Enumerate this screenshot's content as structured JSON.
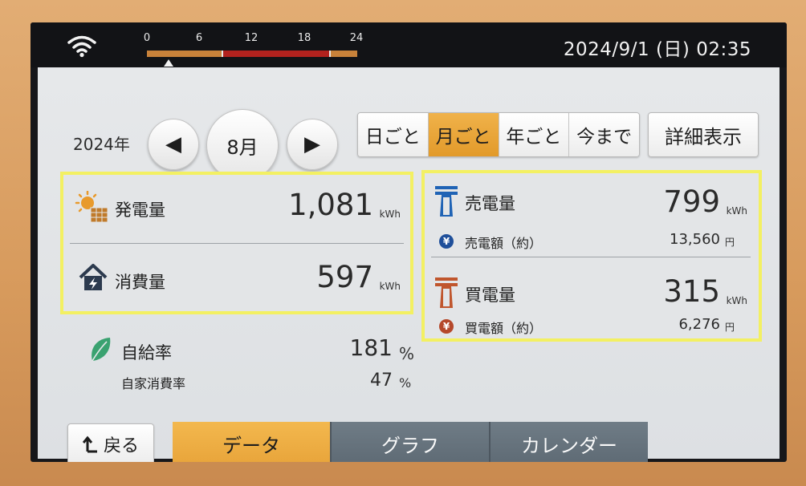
{
  "status": {
    "timeline_ticks": [
      "0",
      "6",
      "12",
      "18",
      "24"
    ],
    "datetime": "2024/9/1 (日) 02:35"
  },
  "nav": {
    "year": "2024年",
    "prev_label": "◀",
    "month": "8月",
    "next_label": "▶",
    "periods": [
      "日ごと",
      "月ごと",
      "年ごと",
      "今まで"
    ],
    "active_period": "月ごと",
    "detail_label": "詳細表示"
  },
  "energy": {
    "generation": {
      "label": "発電量",
      "value": "1,081",
      "unit": "kWh",
      "icon": "solar-panel-icon"
    },
    "consumption": {
      "label": "消費量",
      "value": "597",
      "unit": "kWh",
      "icon": "house-bolt-icon"
    }
  },
  "grid": {
    "sell": {
      "label": "売電量",
      "value": "799",
      "unit": "kWh",
      "amount_label": "売電額（約）",
      "amount": "13,560",
      "amount_unit": "円",
      "icon": "power-pylon-icon",
      "icon_color": "#1f63b5"
    },
    "buy": {
      "label": "買電量",
      "value": "315",
      "unit": "kWh",
      "amount_label": "買電額（約）",
      "amount": "6,276",
      "amount_unit": "円",
      "icon": "power-pylon-icon",
      "icon_color": "#c0562d"
    }
  },
  "self": {
    "sufficiency_label": "自給率",
    "sufficiency_value": "181",
    "sufficiency_unit": "%",
    "consumption_label": "自家消費率",
    "consumption_value": "47",
    "consumption_unit": "%"
  },
  "bottom": {
    "back_label": "戻る",
    "tabs": [
      "データ",
      "グラフ",
      "カレンダー"
    ],
    "active_tab": "データ"
  },
  "colors": {
    "accent": "#e8a43a",
    "highlight_border": "#f3f062",
    "timeline_red": "#b2221e",
    "leaf_green": "#3aa270"
  }
}
